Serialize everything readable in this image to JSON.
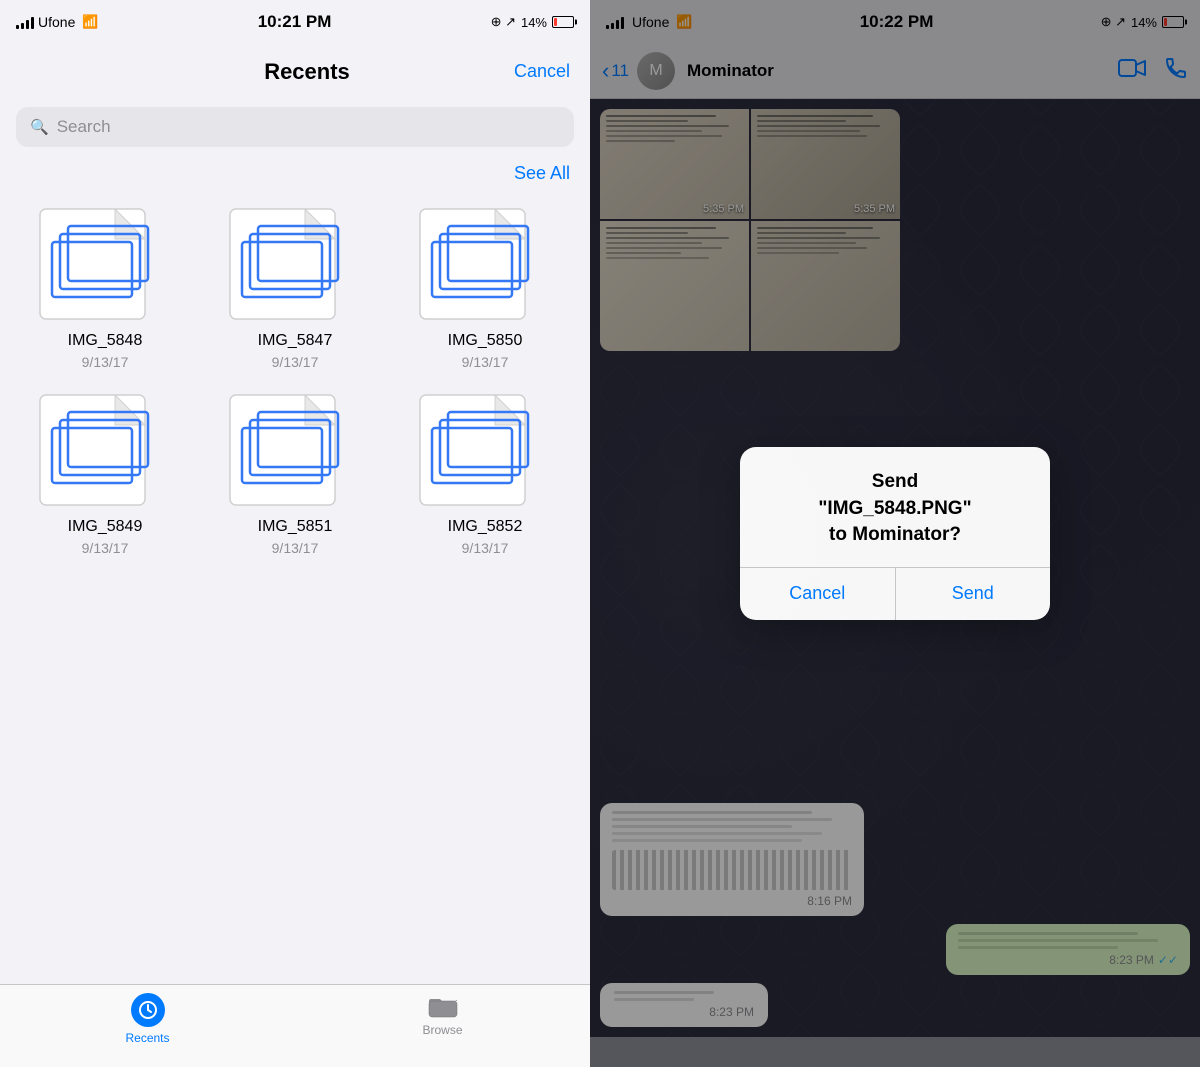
{
  "left": {
    "statusBar": {
      "carrier": "Ufone",
      "time": "10:21 PM",
      "battery": "14%"
    },
    "navBar": {
      "title": "Recents",
      "cancelBtn": "Cancel"
    },
    "search": {
      "placeholder": "Search"
    },
    "seeAll": "See All",
    "files": [
      {
        "name": "IMG_5848",
        "date": "9/13/17"
      },
      {
        "name": "IMG_5847",
        "date": "9/13/17"
      },
      {
        "name": "IMG_5850",
        "date": "9/13/17"
      },
      {
        "name": "IMG_5849",
        "date": "9/13/17"
      },
      {
        "name": "IMG_5851",
        "date": "9/13/17"
      },
      {
        "name": "IMG_5852",
        "date": "9/13/17"
      }
    ],
    "tabs": [
      {
        "label": "Recents",
        "active": true
      },
      {
        "label": "Browse",
        "active": false
      }
    ]
  },
  "right": {
    "statusBar": {
      "carrier": "Ufone",
      "time": "10:22 PM",
      "battery": "14%"
    },
    "chatNav": {
      "backCount": "11",
      "contactName": "Mominator"
    },
    "messages": [
      {
        "type": "image-grid",
        "time": "5:35 PM"
      },
      {
        "type": "incoming-blurred",
        "time": "8:16 PM"
      },
      {
        "type": "outgoing-blurred",
        "time": "8:23 PM",
        "ticks": "✓✓"
      },
      {
        "type": "incoming-short",
        "time": "8:23 PM"
      }
    ],
    "dialog": {
      "title": "Send\n\"IMG_5848.PNG\"\nto Mominator?",
      "cancelBtn": "Cancel",
      "sendBtn": "Send"
    }
  }
}
